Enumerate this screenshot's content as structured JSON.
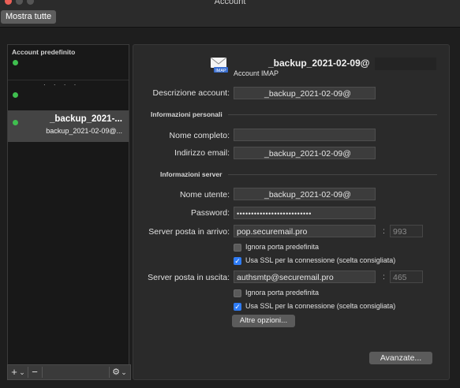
{
  "window": {
    "title": "Account"
  },
  "toolbar": {
    "show_all_label": "Mostra tutte"
  },
  "sidebar": {
    "default_section_label": "Account predefinito",
    "selected_account": {
      "name": "_backup_2021-...",
      "email": "backup_2021-02-09@..."
    },
    "add_label": "+",
    "add_menu_label": "⌄",
    "remove_label": "−",
    "gear_label": "⚙",
    "gear_menu_label": "⌄"
  },
  "account": {
    "title": "_backup_2021-02-09@",
    "type": "Account IMAP",
    "icon_badge": "IMAP"
  },
  "form": {
    "description": {
      "label": "Descrizione account:",
      "value": "_backup_2021-02-09@"
    },
    "personal_header": "Informazioni personali",
    "full_name": {
      "label": "Nome completo:",
      "value": ""
    },
    "email": {
      "label": "Indirizzo email:",
      "value": "_backup_2021-02-09@"
    },
    "server_header": "Informazioni server",
    "username": {
      "label": "Nome utente:",
      "value": "_backup_2021-02-09@"
    },
    "password": {
      "label": "Password:",
      "value": "••••••••••••••••••••••••••"
    },
    "incoming": {
      "label": "Server posta in arrivo:",
      "value": "pop.securemail.pro",
      "port": "993",
      "ignore_default_port": "Ignora porta predefinita",
      "use_ssl": "Usa SSL per la connessione (scelta consigliata)"
    },
    "outgoing": {
      "label": "Server posta in uscita:",
      "value": "authsmtp@securemail.pro",
      "port": "465",
      "ignore_default_port": "Ignora porta predefinita",
      "use_ssl": "Usa SSL per la connessione (scelta consigliata)",
      "more_options": "Altre opzioni..."
    },
    "advanced_button": "Avanzate...",
    "port_separator": ":"
  },
  "colors": {
    "accent": "#2f7cf6",
    "status_dot": "#3fbf4f"
  }
}
